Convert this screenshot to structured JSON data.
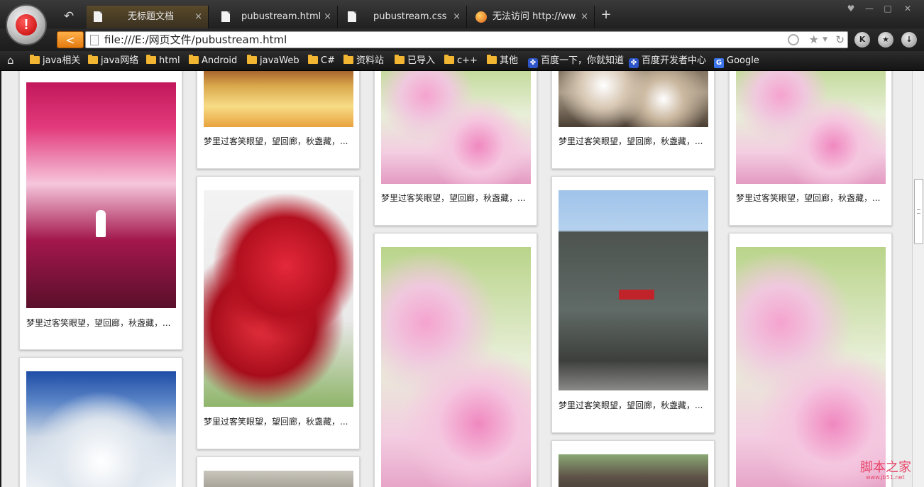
{
  "browser": {
    "tabs": [
      {
        "label": "无标题文档",
        "active": true
      },
      {
        "label": "pubustream.html",
        "active": false
      },
      {
        "label": "pubustream.css",
        "active": false
      },
      {
        "label": "无法访问 http://ww...",
        "active": false
      }
    ],
    "close_glyph": "×",
    "new_tab_glyph": "+",
    "back_glyph": "↶",
    "window_controls": [
      "♥",
      "—",
      "□",
      "✕"
    ],
    "address_url": "file:///E:/网页文件/pubustream.html",
    "nav_back_glyph": "<",
    "star_glyph": "★",
    "refresh_glyph": "↻",
    "round_buttons": [
      "K",
      "★",
      "↓"
    ],
    "logo_glyph": "!"
  },
  "bookmarks": [
    {
      "label": "java相关",
      "icon": "folder-icon"
    },
    {
      "label": "java网络",
      "icon": "folder-icon"
    },
    {
      "label": "html",
      "icon": "folder-icon"
    },
    {
      "label": "Android",
      "icon": "folder-icon"
    },
    {
      "label": "javaWeb",
      "icon": "folder-icon"
    },
    {
      "label": "C#",
      "icon": "folder-icon"
    },
    {
      "label": "资料站",
      "icon": "folder-icon"
    },
    {
      "label": "已导入",
      "icon": "folder-icon"
    },
    {
      "label": "c++",
      "icon": "folder-icon"
    },
    {
      "label": "其他",
      "icon": "folder-icon"
    },
    {
      "label": "百度一下，你就知道",
      "icon": "baidu-paw-icon"
    },
    {
      "label": "百度开发者中心",
      "icon": "baidu-paw-icon"
    },
    {
      "label": "Google",
      "icon": "google-icon"
    }
  ],
  "bookmark_glyphs": {
    "paw": "✤",
    "google": "G",
    "home": "⌂"
  },
  "card_caption": "梦里过客笑眼望，望回廊，秋盏藏，...",
  "watermark": {
    "text": "脚本之家",
    "url": "www.jb51.net"
  }
}
